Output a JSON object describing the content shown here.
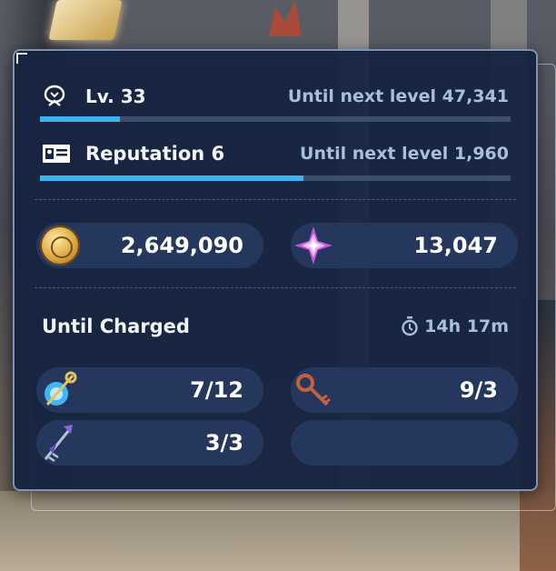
{
  "level": {
    "label": "Lv. 33",
    "next_level_text": "Until next level 47,341",
    "progress": 0.17
  },
  "reputation": {
    "label": "Reputation 6",
    "next_level_text": "Until next level 1,960",
    "progress": 0.56
  },
  "currencies": [
    {
      "icon": "gold-coin-icon",
      "value": "2,649,090"
    },
    {
      "icon": "purple-crystal-icon",
      "value": "13,047"
    }
  ],
  "charge": {
    "title": "Until Charged",
    "timer": "14h 17m"
  },
  "keys": [
    {
      "icon": "blue-orb-key-icon",
      "value": "7/12"
    },
    {
      "icon": "bronze-key-icon",
      "value": "9/3"
    },
    {
      "icon": "crystal-key-icon",
      "value": "3/3"
    },
    {
      "icon": "",
      "value": ""
    }
  ],
  "colors": {
    "panel": "#172442",
    "accent_bar": "#3fb2f0",
    "pill": "#25375c",
    "muted_text": "#a8bfdc"
  }
}
